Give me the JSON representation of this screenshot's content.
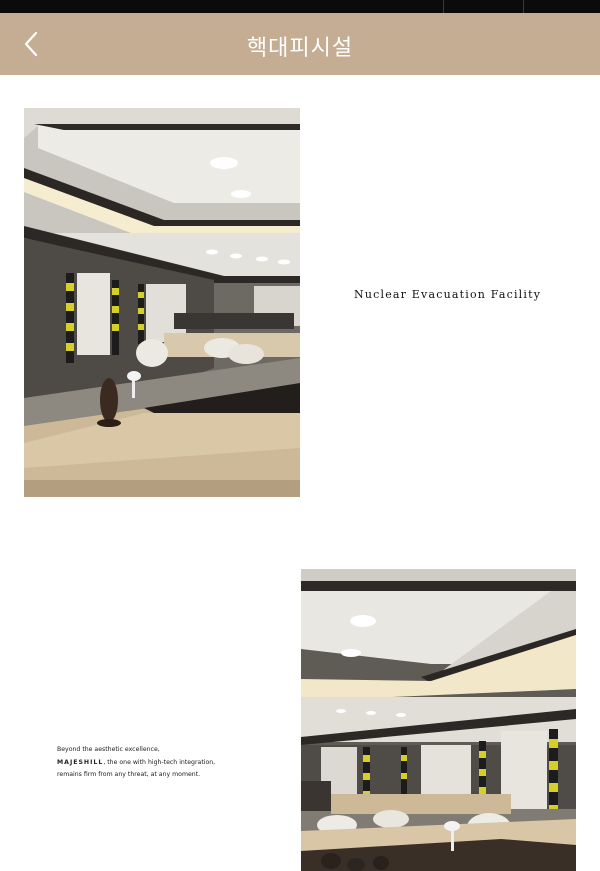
{
  "header": {
    "title": "핵대피시설",
    "back_icon": "chevron-left-icon",
    "background_color": "#c4ad92"
  },
  "caption": {
    "text": "Nuclear Evacuation Facility"
  },
  "tagline": {
    "line1": "Beyond the aesthetic excellence,",
    "brand": "MAJESHILL",
    "line2_rest": ", the one with high-tech integration,",
    "line3": "remains firm from any threat, at any moment."
  }
}
